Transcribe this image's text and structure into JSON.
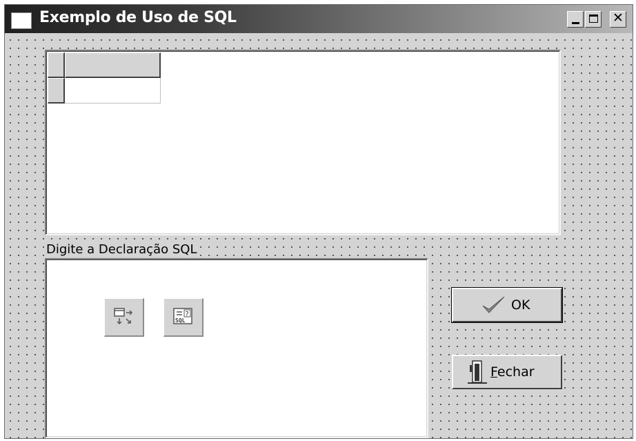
{
  "window": {
    "title": "Exemplo de Uso de SQL",
    "caption_buttons": [
      {
        "icon": "minimize-icon"
      },
      {
        "icon": "maximize-icon"
      },
      {
        "icon": "close-icon",
        "glyph": "✕"
      }
    ]
  },
  "grid": {
    "columns": [
      ""
    ],
    "rows": [
      [
        ""
      ]
    ]
  },
  "sql_section": {
    "label": "Digite a Declaração SQL",
    "memo_value": ""
  },
  "components": [
    {
      "icon": "data-source-component-icon"
    },
    {
      "icon": "sql-query-component-icon",
      "glyph_text": "SQL"
    }
  ],
  "buttons": {
    "ok": {
      "label": "OK",
      "icon": "checkmark-icon"
    },
    "close": {
      "label_underlined": "F",
      "label_rest": "echar",
      "icon": "door-exit-icon"
    }
  },
  "colors": {
    "face": "#d4d4d4",
    "title_gradient_start": "#202020",
    "title_gradient_end": "#b8b8b8",
    "grid_dots": "#4a4a4a"
  }
}
